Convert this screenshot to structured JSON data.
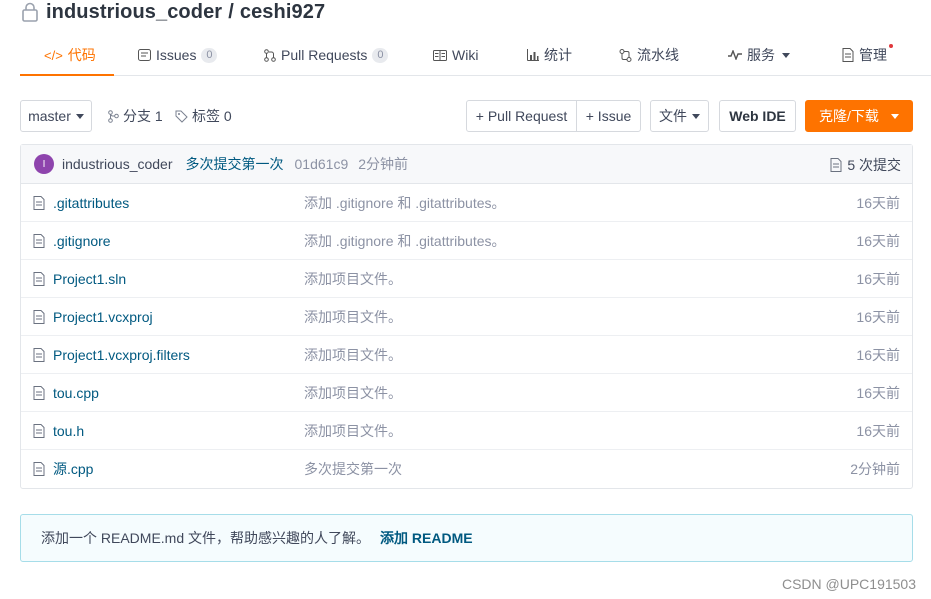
{
  "repo": {
    "owner": "industrious_coder",
    "separator": "/",
    "name": "ceshi927"
  },
  "tabs": [
    {
      "label": "代码",
      "icon": "code-icon"
    },
    {
      "label": "Issues",
      "count": "0",
      "icon": "issue-icon"
    },
    {
      "label": "Pull Requests",
      "count": "0",
      "icon": "pull-request-icon"
    },
    {
      "label": "Wiki",
      "icon": "book-icon"
    },
    {
      "label": "统计",
      "icon": "bar-chart-icon"
    },
    {
      "label": "流水线",
      "icon": "pipeline-icon"
    },
    {
      "label": "服务",
      "icon": "pulse-icon"
    },
    {
      "label": "管理",
      "icon": "settings-doc-icon"
    }
  ],
  "toolbar": {
    "branch_select": "master",
    "branches_label": "分支 1",
    "tags_label": "标签 0",
    "pull_request_button": "+ Pull Request",
    "issue_button": "+ Issue",
    "file_button": "文件",
    "webide_button": "Web IDE",
    "clone_button": "克隆/下载"
  },
  "commit": {
    "avatar_letter": "I",
    "author": "industrious_coder",
    "message": "多次提交第一次",
    "hash": "01d61c9",
    "time": "2分钟前",
    "count_label": "5 次提交"
  },
  "files": [
    {
      "name": ".gitattributes",
      "message": "添加 .gitignore 和 .gitattributes。",
      "time": "16天前"
    },
    {
      "name": ".gitignore",
      "message": "添加 .gitignore 和 .gitattributes。",
      "time": "16天前"
    },
    {
      "name": "Project1.sln",
      "message": "添加项目文件。",
      "time": "16天前"
    },
    {
      "name": "Project1.vcxproj",
      "message": "添加项目文件。",
      "time": "16天前"
    },
    {
      "name": "Project1.vcxproj.filters",
      "message": "添加项目文件。",
      "time": "16天前"
    },
    {
      "name": "tou.cpp",
      "message": "添加项目文件。",
      "time": "16天前"
    },
    {
      "name": "tou.h",
      "message": "添加项目文件。",
      "time": "16天前"
    },
    {
      "name": "源.cpp",
      "message": "多次提交第一次",
      "time": "2分钟前"
    }
  ],
  "readme_tip": {
    "text": "添加一个 README.md 文件，帮助感兴趣的人了解。",
    "link": "添加 README"
  },
  "watermark": "CSDN @UPC191503",
  "colors": {
    "accent": "#fe7300",
    "link": "#005980",
    "muted": "#8c92a4",
    "tip_border": "#a6dde9"
  }
}
